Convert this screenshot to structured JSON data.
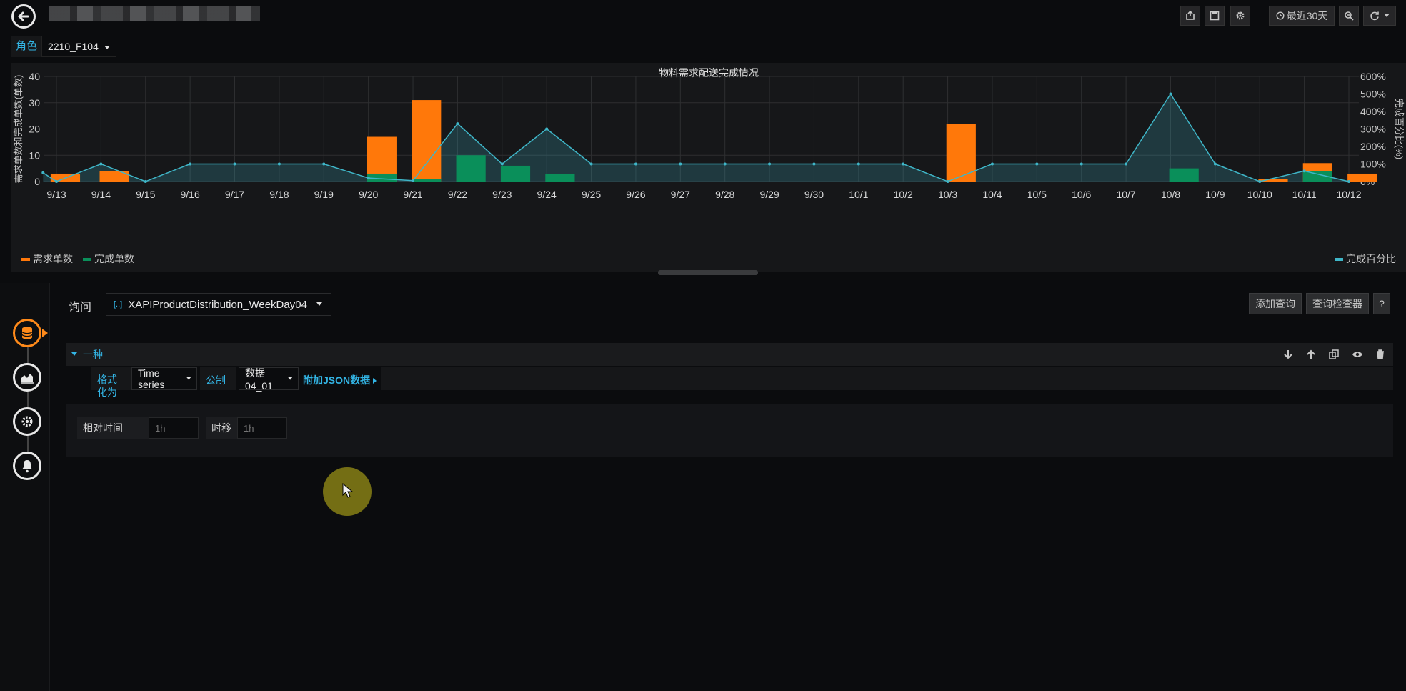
{
  "topbar": {
    "time_range_label": "最近30天"
  },
  "variable": {
    "label": "角色",
    "value": "2210_F104"
  },
  "panel": {
    "title": "物料需求配送完成情况",
    "y_left_label": "需求单数和完成单数(单数)",
    "y_right_label": "完成百分比(%)",
    "legend_left": [
      "需求单数",
      "完成单数"
    ],
    "legend_right": [
      "完成百分比"
    ]
  },
  "chart_data": {
    "type": "bar",
    "title": "物料需求配送完成情况",
    "categories": [
      "9/13",
      "9/14",
      "9/15",
      "9/16",
      "9/17",
      "9/18",
      "9/19",
      "9/20",
      "9/21",
      "9/22",
      "9/23",
      "9/24",
      "9/25",
      "9/26",
      "9/27",
      "9/28",
      "9/29",
      "9/30",
      "10/1",
      "10/2",
      "10/3",
      "10/4",
      "10/5",
      "10/6",
      "10/7",
      "10/8",
      "10/9",
      "10/10",
      "10/11",
      "10/12"
    ],
    "y_left_ticks": [
      "0",
      "10",
      "20",
      "30",
      "40"
    ],
    "y_right_ticks": [
      "0%",
      "100%",
      "200%",
      "300%",
      "400%",
      "500%",
      "600%"
    ],
    "ylim_left": [
      0,
      40
    ],
    "ylim_right": [
      0,
      600
    ],
    "bar_series": [
      {
        "name": "需求单数",
        "color": "#ff780a",
        "points": [
          [
            0.2,
            3
          ],
          [
            1.3,
            4
          ],
          [
            7.3,
            17
          ],
          [
            8.3,
            31
          ],
          [
            20.3,
            22
          ],
          [
            27.3,
            1
          ],
          [
            28.3,
            7
          ],
          [
            29.3,
            3
          ]
        ]
      },
      {
        "name": "完成单数",
        "color": "#0a8f5a",
        "points": [
          [
            7.3,
            3
          ],
          [
            8.3,
            1
          ],
          [
            9.3,
            10
          ],
          [
            10.3,
            6
          ],
          [
            11.3,
            3
          ],
          [
            25.3,
            5
          ],
          [
            28.3,
            4
          ]
        ]
      }
    ],
    "line_series": {
      "name": "完成百分比",
      "color": "#3fb6c8",
      "points": [
        [
          -0.3,
          50
        ],
        [
          0.0,
          0
        ],
        [
          1.0,
          100
        ],
        [
          2.0,
          0
        ],
        [
          3.0,
          100
        ],
        [
          4.0,
          100
        ],
        [
          5.0,
          100
        ],
        [
          6.0,
          100
        ],
        [
          7.0,
          20
        ],
        [
          8.0,
          5
        ],
        [
          9.0,
          330
        ],
        [
          10.0,
          100
        ],
        [
          11.0,
          300
        ],
        [
          12.0,
          100
        ],
        [
          13.0,
          100
        ],
        [
          14.0,
          100
        ],
        [
          15.0,
          100
        ],
        [
          16.0,
          100
        ],
        [
          17.0,
          100
        ],
        [
          18.0,
          100
        ],
        [
          19.0,
          100
        ],
        [
          20.0,
          0
        ],
        [
          21.0,
          100
        ],
        [
          22.0,
          100
        ],
        [
          23.0,
          100
        ],
        [
          24.0,
          100
        ],
        [
          25.0,
          500
        ],
        [
          26.0,
          100
        ],
        [
          27.0,
          0
        ],
        [
          28.0,
          60
        ],
        [
          29.0,
          0
        ]
      ]
    },
    "grid": true,
    "legend": "bottom"
  },
  "editor": {
    "query_label": "询问",
    "datasource": "XAPIProductDistribution_WeekDay04",
    "add_query": "添加查询",
    "query_inspector": "查询检查器",
    "help": "?",
    "query_name": "一种",
    "format_label": "格式化为",
    "format_value": "Time series",
    "metric_label": "公制",
    "metric_value": "数据04_01",
    "json_link": "附加JSON数据",
    "relative_time_label": "相对时间",
    "relative_time_placeholder": "1h",
    "offset_label": "时移",
    "offset_placeholder": "1h"
  }
}
